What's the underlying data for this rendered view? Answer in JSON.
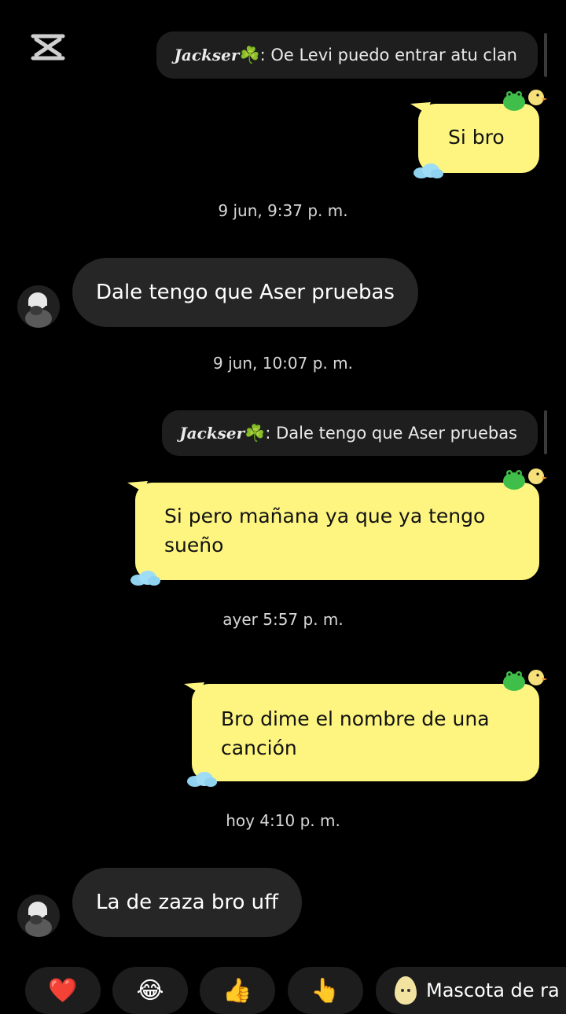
{
  "watermark": {
    "icon": "capcut-logo-icon"
  },
  "messages": [
    {
      "type": "reply_quote",
      "name": "Jackser",
      "clover": "☘️",
      "text": ": Oe Levi puedo entrar atu clan"
    },
    {
      "type": "sent",
      "text": "Si bro"
    },
    {
      "type": "timestamp",
      "text": "9 jun, 9:37 p. m."
    },
    {
      "type": "received",
      "text": "Dale tengo que Aser pruebas"
    },
    {
      "type": "timestamp",
      "text": "9 jun, 10:07 p. m."
    },
    {
      "type": "reply_quote",
      "name": "Jackser",
      "clover": "☘️",
      "text": ": Dale tengo que Aser pruebas"
    },
    {
      "type": "sent",
      "line1": "Si pero mañana ya que ya tengo",
      "line2": "sueño"
    },
    {
      "type": "timestamp",
      "text": "ayer 5:57 p. m."
    },
    {
      "type": "sent",
      "line1": "Bro dime el nombre de una",
      "line2": "canción"
    },
    {
      "type": "timestamp",
      "text": "hoy 4:10 p. m."
    },
    {
      "type": "received",
      "text": "La de zaza bro uff"
    }
  ],
  "quick_reactions": [
    {
      "emoji": "❤️",
      "icon": "heart-icon"
    },
    {
      "emoji": "😂",
      "icon": "laughing-face-icon"
    },
    {
      "emoji": "👍",
      "icon": "thumbs-up-icon"
    },
    {
      "emoji": "👆",
      "icon": "pointing-up-icon"
    }
  ],
  "pet_chip": {
    "icon": "egg-pet-icon",
    "label": "Mascota de ra"
  },
  "colors": {
    "background": "#000000",
    "sent_bubble": "#fdf580",
    "received_bubble": "#262626",
    "reply_quote": "#1e1e1e"
  }
}
